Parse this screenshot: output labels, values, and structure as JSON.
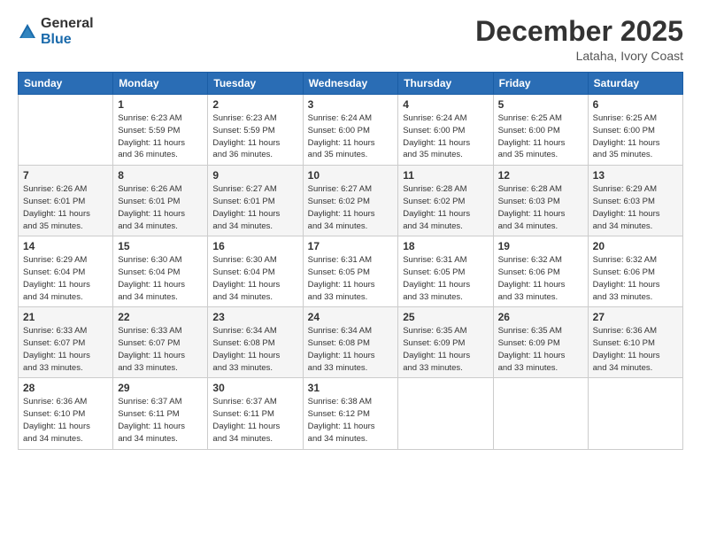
{
  "logo": {
    "general": "General",
    "blue": "Blue"
  },
  "title": "December 2025",
  "location": "Lataha, Ivory Coast",
  "days_header": [
    "Sunday",
    "Monday",
    "Tuesday",
    "Wednesday",
    "Thursday",
    "Friday",
    "Saturday"
  ],
  "weeks": [
    [
      {
        "day": "",
        "info": ""
      },
      {
        "day": "1",
        "info": "Sunrise: 6:23 AM\nSunset: 5:59 PM\nDaylight: 11 hours\nand 36 minutes."
      },
      {
        "day": "2",
        "info": "Sunrise: 6:23 AM\nSunset: 5:59 PM\nDaylight: 11 hours\nand 36 minutes."
      },
      {
        "day": "3",
        "info": "Sunrise: 6:24 AM\nSunset: 6:00 PM\nDaylight: 11 hours\nand 35 minutes."
      },
      {
        "day": "4",
        "info": "Sunrise: 6:24 AM\nSunset: 6:00 PM\nDaylight: 11 hours\nand 35 minutes."
      },
      {
        "day": "5",
        "info": "Sunrise: 6:25 AM\nSunset: 6:00 PM\nDaylight: 11 hours\nand 35 minutes."
      },
      {
        "day": "6",
        "info": "Sunrise: 6:25 AM\nSunset: 6:00 PM\nDaylight: 11 hours\nand 35 minutes."
      }
    ],
    [
      {
        "day": "7",
        "info": "Sunrise: 6:26 AM\nSunset: 6:01 PM\nDaylight: 11 hours\nand 35 minutes."
      },
      {
        "day": "8",
        "info": "Sunrise: 6:26 AM\nSunset: 6:01 PM\nDaylight: 11 hours\nand 34 minutes."
      },
      {
        "day": "9",
        "info": "Sunrise: 6:27 AM\nSunset: 6:01 PM\nDaylight: 11 hours\nand 34 minutes."
      },
      {
        "day": "10",
        "info": "Sunrise: 6:27 AM\nSunset: 6:02 PM\nDaylight: 11 hours\nand 34 minutes."
      },
      {
        "day": "11",
        "info": "Sunrise: 6:28 AM\nSunset: 6:02 PM\nDaylight: 11 hours\nand 34 minutes."
      },
      {
        "day": "12",
        "info": "Sunrise: 6:28 AM\nSunset: 6:03 PM\nDaylight: 11 hours\nand 34 minutes."
      },
      {
        "day": "13",
        "info": "Sunrise: 6:29 AM\nSunset: 6:03 PM\nDaylight: 11 hours\nand 34 minutes."
      }
    ],
    [
      {
        "day": "14",
        "info": "Sunrise: 6:29 AM\nSunset: 6:04 PM\nDaylight: 11 hours\nand 34 minutes."
      },
      {
        "day": "15",
        "info": "Sunrise: 6:30 AM\nSunset: 6:04 PM\nDaylight: 11 hours\nand 34 minutes."
      },
      {
        "day": "16",
        "info": "Sunrise: 6:30 AM\nSunset: 6:04 PM\nDaylight: 11 hours\nand 34 minutes."
      },
      {
        "day": "17",
        "info": "Sunrise: 6:31 AM\nSunset: 6:05 PM\nDaylight: 11 hours\nand 33 minutes."
      },
      {
        "day": "18",
        "info": "Sunrise: 6:31 AM\nSunset: 6:05 PM\nDaylight: 11 hours\nand 33 minutes."
      },
      {
        "day": "19",
        "info": "Sunrise: 6:32 AM\nSunset: 6:06 PM\nDaylight: 11 hours\nand 33 minutes."
      },
      {
        "day": "20",
        "info": "Sunrise: 6:32 AM\nSunset: 6:06 PM\nDaylight: 11 hours\nand 33 minutes."
      }
    ],
    [
      {
        "day": "21",
        "info": "Sunrise: 6:33 AM\nSunset: 6:07 PM\nDaylight: 11 hours\nand 33 minutes."
      },
      {
        "day": "22",
        "info": "Sunrise: 6:33 AM\nSunset: 6:07 PM\nDaylight: 11 hours\nand 33 minutes."
      },
      {
        "day": "23",
        "info": "Sunrise: 6:34 AM\nSunset: 6:08 PM\nDaylight: 11 hours\nand 33 minutes."
      },
      {
        "day": "24",
        "info": "Sunrise: 6:34 AM\nSunset: 6:08 PM\nDaylight: 11 hours\nand 33 minutes."
      },
      {
        "day": "25",
        "info": "Sunrise: 6:35 AM\nSunset: 6:09 PM\nDaylight: 11 hours\nand 33 minutes."
      },
      {
        "day": "26",
        "info": "Sunrise: 6:35 AM\nSunset: 6:09 PM\nDaylight: 11 hours\nand 33 minutes."
      },
      {
        "day": "27",
        "info": "Sunrise: 6:36 AM\nSunset: 6:10 PM\nDaylight: 11 hours\nand 34 minutes."
      }
    ],
    [
      {
        "day": "28",
        "info": "Sunrise: 6:36 AM\nSunset: 6:10 PM\nDaylight: 11 hours\nand 34 minutes."
      },
      {
        "day": "29",
        "info": "Sunrise: 6:37 AM\nSunset: 6:11 PM\nDaylight: 11 hours\nand 34 minutes."
      },
      {
        "day": "30",
        "info": "Sunrise: 6:37 AM\nSunset: 6:11 PM\nDaylight: 11 hours\nand 34 minutes."
      },
      {
        "day": "31",
        "info": "Sunrise: 6:38 AM\nSunset: 6:12 PM\nDaylight: 11 hours\nand 34 minutes."
      },
      {
        "day": "",
        "info": ""
      },
      {
        "day": "",
        "info": ""
      },
      {
        "day": "",
        "info": ""
      }
    ]
  ]
}
